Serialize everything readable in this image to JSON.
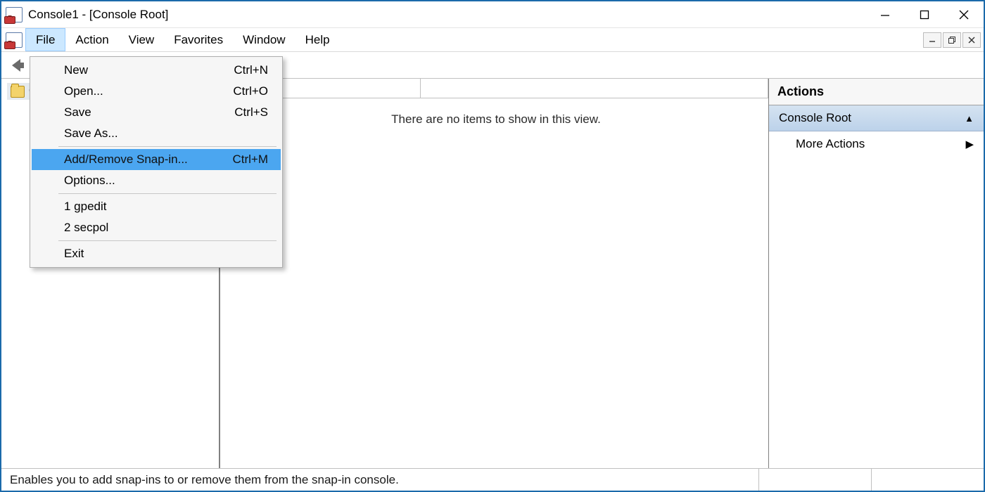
{
  "title": "Console1 - [Console Root]",
  "menubar": {
    "items": [
      "File",
      "Action",
      "View",
      "Favorites",
      "Window",
      "Help"
    ],
    "active_index": 0
  },
  "file_menu": {
    "groups": [
      [
        {
          "label": "New",
          "accel": "Ctrl+N"
        },
        {
          "label": "Open...",
          "accel": "Ctrl+O"
        },
        {
          "label": "Save",
          "accel": "Ctrl+S"
        },
        {
          "label": "Save As...",
          "accel": ""
        }
      ],
      [
        {
          "label": "Add/Remove Snap-in...",
          "accel": "Ctrl+M",
          "highlight": true
        },
        {
          "label": "Options...",
          "accel": ""
        }
      ],
      [
        {
          "label": "1 gpedit",
          "accel": ""
        },
        {
          "label": "2 secpol",
          "accel": ""
        }
      ],
      [
        {
          "label": "Exit",
          "accel": ""
        }
      ]
    ]
  },
  "tree": {
    "root_label": "Console Root"
  },
  "list": {
    "empty_message": "There are no items to show in this view."
  },
  "actions": {
    "title": "Actions",
    "context": "Console Root",
    "more": "More Actions"
  },
  "status": "Enables you to add snap-ins to or remove them from the snap-in console."
}
